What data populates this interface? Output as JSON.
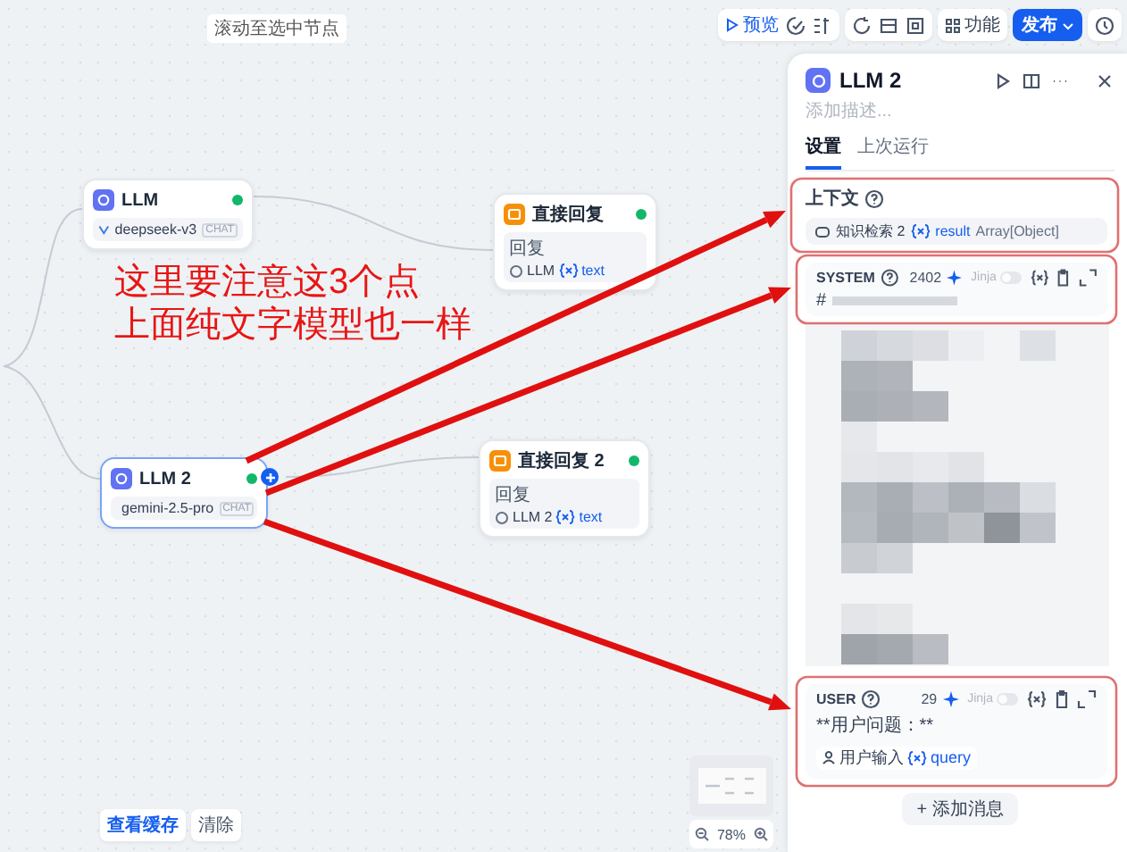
{
  "canvas_hint": "滚动至选中节点",
  "toolbar": {
    "preview": "预览",
    "features": "功能",
    "publish": "发布"
  },
  "nodes": [
    {
      "kind": "llm",
      "title": "LLM",
      "model": "deepseek-v3",
      "mode": "CHAT",
      "selected": false
    },
    {
      "kind": "answer",
      "title": "直接回复",
      "label": "回复",
      "source": "LLM",
      "variable": "text",
      "selected": false
    },
    {
      "kind": "llm",
      "title": "LLM 2",
      "model": "gemini-2.5-pro",
      "mode": "CHAT",
      "selected": true
    },
    {
      "kind": "answer",
      "title": "直接回复 2",
      "label": "回复",
      "source": "LLM 2",
      "variable": "text",
      "selected": false
    }
  ],
  "bottom_bar": {
    "cache": "查看缓存",
    "clear": "清除",
    "zoom": "78%"
  },
  "panel": {
    "title": "LLM 2",
    "description_placeholder": "添加描述...",
    "tabs": [
      {
        "label": "设置",
        "selected": true
      },
      {
        "label": "上次运行",
        "selected": false
      }
    ],
    "context": {
      "label": "上下文",
      "source": "知识检索 2",
      "variable": "result",
      "type": "Array[Object]"
    },
    "messages": [
      {
        "role": "SYSTEM",
        "count": "2402",
        "jinja": "Jinja",
        "jinja_on": false,
        "text": "#"
      },
      {
        "role": "USER",
        "count": "29",
        "jinja": "Jinja",
        "jinja_on": false,
        "text": "**用户问题：**",
        "source": "用户输入",
        "variable": "query"
      }
    ],
    "add_message": "+ 添加消息"
  },
  "annotation": {
    "note": [
      "这里要注意这3个点",
      "上面纯文字模型也一样"
    ]
  }
}
